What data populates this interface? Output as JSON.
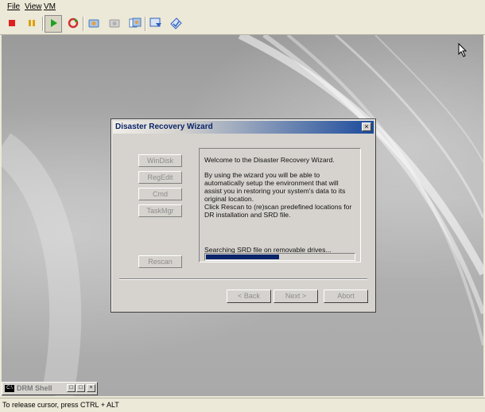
{
  "menubar": {
    "file": "File",
    "view": "View",
    "vm": "VM"
  },
  "toolbar": {
    "buttons": [
      {
        "name": "stop-icon",
        "color": "#e02020"
      },
      {
        "name": "pause-icon",
        "color": "#e0a000"
      },
      {
        "name": "play-icon",
        "color": "#20a020"
      },
      {
        "name": "reset-icon",
        "color": "#d03030"
      },
      {
        "name": "snapshot-icon",
        "color": "#4a7ab8"
      },
      {
        "name": "revert-snapshot-icon",
        "color": "#9a9a9a"
      },
      {
        "name": "snapshot-manager-icon",
        "color": "#4a7ab8"
      },
      {
        "name": "fullscreen-icon",
        "color": "#3060c0"
      },
      {
        "name": "unity-icon",
        "color": "#3060c0"
      }
    ]
  },
  "dialog": {
    "title": "Disaster Recovery Wizard",
    "close_label": "×",
    "side_buttons": {
      "windisk": "WinDisk",
      "regedit": "RegEdit",
      "cmd": "Cmd",
      "taskmgr": "TaskMgr",
      "rescan": "Rescan"
    },
    "welcome": "Welcome to the Disaster Recovery Wizard.",
    "intro": "By using the wizard you will be able to automatically setup the environment that will assist you in restoring your system's data to its original location.",
    "rescan_hint": "Click Rescan to (re)scan predefined locations for DR installation and SRD file.",
    "status": "Searching SRD file on removable drives...",
    "progress_fraction": 0.5,
    "back_label": "< Back",
    "next_label": "Next >",
    "abort_label": "Abort"
  },
  "console": {
    "icon_text": "C:\\",
    "title": "DRM Shell"
  },
  "statusbar": {
    "text": "To release cursor, press CTRL + ALT"
  }
}
